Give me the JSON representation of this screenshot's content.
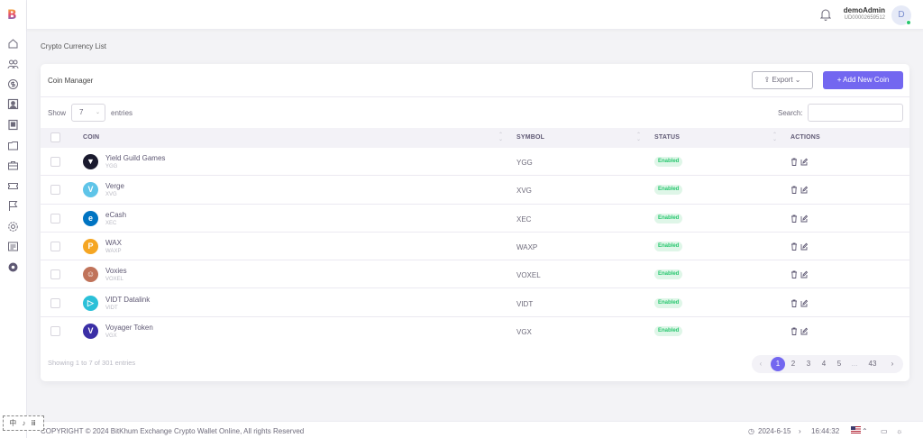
{
  "app": {
    "logo_letter": "B",
    "accent_color": "#7367f0",
    "success_color": "#28c76f"
  },
  "sidebar": {
    "items": [
      {
        "icon": "home-icon"
      },
      {
        "icon": "users-icon"
      },
      {
        "icon": "dollar-icon"
      },
      {
        "icon": "user-card-icon"
      },
      {
        "icon": "document-icon"
      },
      {
        "icon": "folder-icon"
      },
      {
        "icon": "briefcase-icon"
      },
      {
        "icon": "ticket-icon"
      },
      {
        "icon": "flag-icon"
      },
      {
        "icon": "settings-icon"
      },
      {
        "icon": "message-icon"
      },
      {
        "icon": "gear-icon"
      }
    ]
  },
  "header": {
    "user_name": "demoAdmin",
    "user_id": "UD00002659512",
    "avatar_letter": "D"
  },
  "page": {
    "title": "Crypto Currency List"
  },
  "card": {
    "title": "Coin Manager",
    "export_label": "Export",
    "add_label": "Add New Coin",
    "show_label": "Show",
    "entries_value": "7",
    "entries_label": "entries",
    "search_label": "Search:",
    "search_value": ""
  },
  "table": {
    "columns": [
      "COIN",
      "SYMBOL",
      "STATUS",
      "ACTIONS"
    ],
    "rows": [
      {
        "name": "Yield Guild Games",
        "sub": "YGG",
        "symbol": "YGG",
        "status": "Enabled",
        "icon_color": "#1a1a2e",
        "icon_glyph": "▼"
      },
      {
        "name": "Verge",
        "sub": "XVG",
        "symbol": "XVG",
        "status": "Enabled",
        "icon_color": "#5ec4e8",
        "icon_glyph": "V"
      },
      {
        "name": "eCash",
        "sub": "XEC",
        "symbol": "XEC",
        "status": "Enabled",
        "icon_color": "#0074c2",
        "icon_glyph": "e"
      },
      {
        "name": "WAX",
        "sub": "WAXP",
        "symbol": "WAXP",
        "status": "Enabled",
        "icon_color": "#f5a623",
        "icon_glyph": "P"
      },
      {
        "name": "Voxies",
        "sub": "VOXEL",
        "symbol": "VOXEL",
        "status": "Enabled",
        "icon_color": "#c0735a",
        "icon_glyph": "☺"
      },
      {
        "name": "VIDT Datalink",
        "sub": "VIDT",
        "symbol": "VIDT",
        "status": "Enabled",
        "icon_color": "#2bc0d8",
        "icon_glyph": "▷"
      },
      {
        "name": "Voyager Token",
        "sub": "VGX",
        "symbol": "VGX",
        "status": "Enabled",
        "icon_color": "#3b2fa6",
        "icon_glyph": "V"
      }
    ]
  },
  "pagination": {
    "info": "Showing 1 to 7 of 301 entries",
    "prev": "‹",
    "pages": [
      "1",
      "2",
      "3",
      "4",
      "5",
      "...",
      "43"
    ],
    "next": "›",
    "active": "1"
  },
  "footer": {
    "copyright": "COPYRIGHT © 2024 BitKhum Exchange Crypto Wallet Online, All rights Reserved",
    "date": "2024-6-15",
    "time": "16:44:32"
  },
  "toolbox": {
    "label": "中 ♪ ⅲ"
  }
}
